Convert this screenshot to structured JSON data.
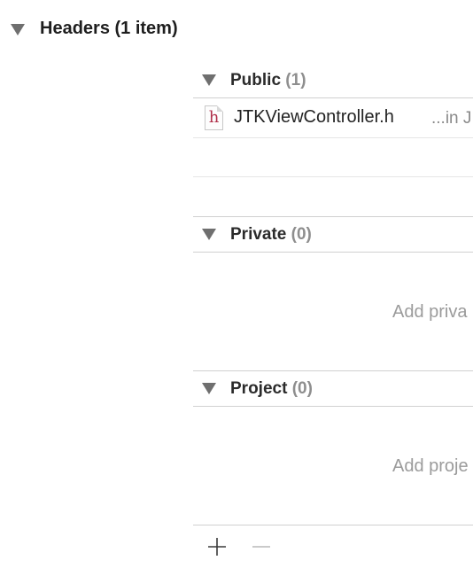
{
  "section": {
    "title": "Headers (1 item)"
  },
  "groups": [
    {
      "name": "Public",
      "count": "(1)",
      "files": [
        {
          "name": "JTKViewController.h",
          "location": "...in J",
          "icon": "h-header-file-icon",
          "icon_letter": "h"
        }
      ]
    },
    {
      "name": "Private",
      "count": "(0)",
      "placeholder": "Add priva"
    },
    {
      "name": "Project",
      "count": "(0)",
      "placeholder": "Add proje"
    }
  ],
  "toolbar": {
    "add_symbol": "+",
    "remove_symbol": "—"
  },
  "colors": {
    "disclosure_triangle": "#6f6f6f",
    "header_file_glyph": "#b0304a",
    "separator": "#d0d0d0",
    "placeholder_text": "#9b9b9b",
    "count_text": "#8e8e8e"
  }
}
